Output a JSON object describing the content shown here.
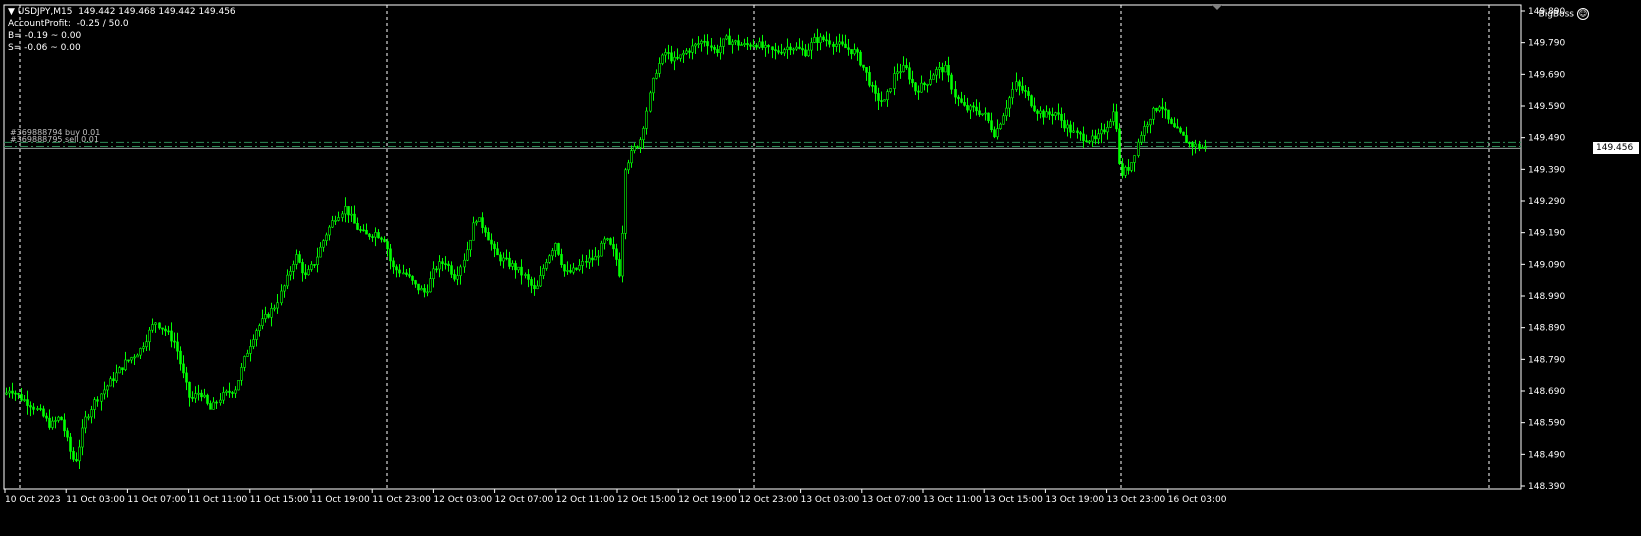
{
  "header": {
    "symbol_line": "USDJPY,M15  149.442 149.468 149.442 149.456",
    "account_profit": "AccountProfit:  -0.25 / 50.0",
    "buy_line": "B= -0.19 ~ 0.00",
    "sell_line": "S= -0.06 ~ 0.00",
    "ea_name": "BigBoss",
    "ea_icon": "smiley-icon"
  },
  "orders": {
    "buy_label": "#369888794 buy 0.01",
    "sell_label": "#369888795 sell 0.01"
  },
  "current_price_label": "149.456",
  "colors": {
    "candle": "#00ff00",
    "background": "#000000",
    "grid": "#ffffff",
    "order_line": "#2e8b57"
  },
  "chart_data": {
    "type": "candlestick",
    "symbol": "USDJPY",
    "timeframe": "M15",
    "ylim": [
      148.39,
      149.89
    ],
    "y_ticks": [
      "149.890",
      "149.790",
      "149.690",
      "149.590",
      "149.490",
      "149.390",
      "149.290",
      "149.190",
      "149.090",
      "148.990",
      "148.890",
      "148.790",
      "148.690",
      "148.590",
      "148.490",
      "148.390"
    ],
    "x_ticks": [
      "10 Oct 2023",
      "11 Oct 03:00",
      "11 Oct 07:00",
      "11 Oct 11:00",
      "11 Oct 15:00",
      "11 Oct 19:00",
      "11 Oct 23:00",
      "12 Oct 03:00",
      "12 Oct 07:00",
      "12 Oct 11:00",
      "12 Oct 15:00",
      "12 Oct 19:00",
      "12 Oct 23:00",
      "13 Oct 03:00",
      "13 Oct 07:00",
      "13 Oct 11:00",
      "13 Oct 15:00",
      "13 Oct 19:00",
      "13 Oct 23:00",
      "16 Oct 03:00"
    ],
    "day_separators": [
      "11 Oct 2023",
      "12 Oct 2023",
      "13 Oct 2023",
      "16 Oct 2023"
    ],
    "order_lines": [
      149.475,
      149.462
    ],
    "current_price": 149.456,
    "price_path": [
      [
        0,
        148.66
      ],
      [
        10,
        148.7
      ],
      [
        20,
        148.67
      ],
      [
        30,
        148.65
      ],
      [
        40,
        148.62
      ],
      [
        50,
        148.58
      ],
      [
        60,
        148.61
      ],
      [
        70,
        148.5
      ],
      [
        75,
        148.46
      ],
      [
        85,
        148.6
      ],
      [
        95,
        148.66
      ],
      [
        110,
        148.72
      ],
      [
        125,
        148.78
      ],
      [
        140,
        148.82
      ],
      [
        155,
        148.91
      ],
      [
        165,
        148.88
      ],
      [
        175,
        148.84
      ],
      [
        182,
        148.75
      ],
      [
        190,
        148.66
      ],
      [
        200,
        148.69
      ],
      [
        210,
        148.63
      ],
      [
        220,
        148.67
      ],
      [
        235,
        148.7
      ],
      [
        245,
        148.8
      ],
      [
        255,
        148.88
      ],
      [
        265,
        148.92
      ],
      [
        275,
        148.96
      ],
      [
        285,
        149.03
      ],
      [
        295,
        149.12
      ],
      [
        305,
        149.05
      ],
      [
        315,
        149.1
      ],
      [
        325,
        149.18
      ],
      [
        335,
        149.24
      ],
      [
        345,
        149.27
      ],
      [
        355,
        149.21
      ],
      [
        365,
        149.18
      ],
      [
        375,
        149.19
      ],
      [
        385,
        149.17
      ],
      [
        392,
        149.08
      ],
      [
        405,
        149.06
      ],
      [
        415,
        149.02
      ],
      [
        425,
        149.0
      ],
      [
        435,
        149.08
      ],
      [
        445,
        149.1
      ],
      [
        455,
        149.05
      ],
      [
        465,
        149.12
      ],
      [
        475,
        149.24
      ],
      [
        485,
        149.2
      ],
      [
        495,
        149.12
      ],
      [
        505,
        149.1
      ],
      [
        515,
        149.08
      ],
      [
        525,
        149.05
      ],
      [
        535,
        149.0
      ],
      [
        545,
        149.1
      ],
      [
        555,
        149.16
      ],
      [
        565,
        149.06
      ],
      [
        575,
        149.07
      ],
      [
        585,
        149.1
      ],
      [
        595,
        149.11
      ],
      [
        605,
        149.17
      ],
      [
        615,
        149.12
      ],
      [
        620,
        149.05
      ],
      [
        625,
        149.4
      ],
      [
        633,
        149.45
      ],
      [
        640,
        149.48
      ],
      [
        648,
        149.6
      ],
      [
        655,
        149.7
      ],
      [
        665,
        149.76
      ],
      [
        675,
        149.73
      ],
      [
        685,
        149.76
      ],
      [
        695,
        149.78
      ],
      [
        705,
        149.8
      ],
      [
        715,
        149.76
      ],
      [
        725,
        149.8
      ],
      [
        735,
        149.79
      ],
      [
        745,
        149.78
      ],
      [
        755,
        149.79
      ],
      [
        765,
        149.77
      ],
      [
        775,
        149.76
      ],
      [
        790,
        149.78
      ],
      [
        805,
        149.76
      ],
      [
        815,
        149.8
      ],
      [
        825,
        149.8
      ],
      [
        840,
        149.78
      ],
      [
        855,
        149.76
      ],
      [
        865,
        149.7
      ],
      [
        875,
        149.62
      ],
      [
        885,
        149.6
      ],
      [
        895,
        149.7
      ],
      [
        905,
        149.71
      ],
      [
        915,
        149.64
      ],
      [
        925,
        149.66
      ],
      [
        935,
        149.7
      ],
      [
        945,
        149.71
      ],
      [
        955,
        149.62
      ],
      [
        965,
        149.58
      ],
      [
        975,
        149.58
      ],
      [
        985,
        149.56
      ],
      [
        995,
        149.5
      ],
      [
        1005,
        149.58
      ],
      [
        1015,
        149.66
      ],
      [
        1025,
        149.63
      ],
      [
        1035,
        149.58
      ],
      [
        1045,
        149.56
      ],
      [
        1055,
        149.57
      ],
      [
        1065,
        149.53
      ],
      [
        1075,
        149.5
      ],
      [
        1085,
        149.49
      ],
      [
        1095,
        149.48
      ],
      [
        1105,
        149.52
      ],
      [
        1115,
        149.58
      ],
      [
        1120,
        149.37
      ],
      [
        1130,
        149.4
      ],
      [
        1140,
        149.5
      ],
      [
        1150,
        149.56
      ],
      [
        1160,
        149.6
      ],
      [
        1170,
        149.53
      ],
      [
        1180,
        149.5
      ],
      [
        1190,
        149.47
      ],
      [
        1200,
        149.46
      ],
      [
        1207,
        149.456
      ]
    ]
  }
}
